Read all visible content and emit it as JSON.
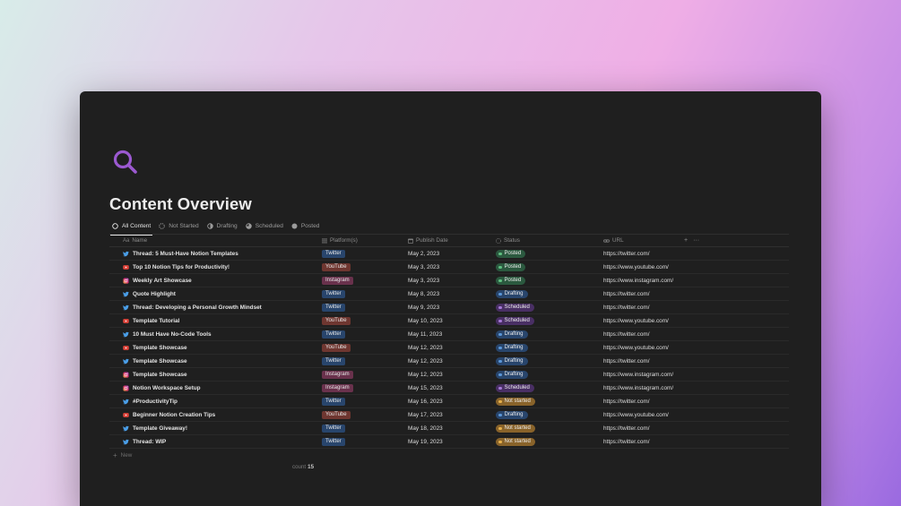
{
  "page": {
    "title": "Content Overview",
    "icon": "search-icon",
    "accent": "#9b59d0"
  },
  "tabs": [
    {
      "label": "All Content",
      "icon": "circle-outline-icon",
      "active": true
    },
    {
      "label": "Not Started",
      "icon": "circle-empty-icon",
      "active": false
    },
    {
      "label": "Drafting",
      "icon": "circle-half-icon",
      "active": false
    },
    {
      "label": "Scheduled",
      "icon": "circle-three-quarter-icon",
      "active": false
    },
    {
      "label": "Posted",
      "icon": "circle-full-icon",
      "active": false
    }
  ],
  "columns": {
    "name": {
      "label": "Name",
      "icon": "Aa"
    },
    "platform": {
      "label": "Platform(s)",
      "icon": "list-icon"
    },
    "date": {
      "label": "Publish Date",
      "icon": "calendar-icon"
    },
    "status": {
      "label": "Status",
      "icon": "status-icon"
    },
    "url": {
      "label": "URL",
      "icon": "link-icon"
    },
    "add": "+",
    "more": "···"
  },
  "platform_colors": {
    "Twitter": "#28456c",
    "YouTube": "#6e3630",
    "Instagram": "#69314c"
  },
  "status_colors": {
    "Posted": {
      "bg": "#2b593f",
      "dot": "#5fbf80"
    },
    "Drafting": {
      "bg": "#28456c",
      "dot": "#5b97d8"
    },
    "Scheduled": {
      "bg": "#492f64",
      "dot": "#a57ad6"
    },
    "Not started": {
      "bg": "#89632a",
      "dot": "#e6b04c"
    }
  },
  "rows": [
    {
      "name": "Thread: 5 Must-Have Notion Templates",
      "platform": "Twitter",
      "date": "May 2, 2023",
      "status": "Posted",
      "url": "https://twitter.com/"
    },
    {
      "name": "Top 10 Notion Tips for Productivity!",
      "platform": "YouTube",
      "date": "May 3, 2023",
      "status": "Posted",
      "url": "https://www.youtube.com/"
    },
    {
      "name": "Weekly Art Showcase",
      "platform": "Instagram",
      "date": "May 3, 2023",
      "status": "Posted",
      "url": "https://www.instagram.com/"
    },
    {
      "name": "Quote Highlight",
      "platform": "Twitter",
      "date": "May 8, 2023",
      "status": "Drafting",
      "url": "https://twitter.com/"
    },
    {
      "name": "Thread: Developing a Personal Growth Mindset",
      "platform": "Twitter",
      "date": "May 9, 2023",
      "status": "Scheduled",
      "url": "https://twitter.com/"
    },
    {
      "name": "Template Tutorial",
      "platform": "YouTube",
      "date": "May 10, 2023",
      "status": "Scheduled",
      "url": "https://www.youtube.com/"
    },
    {
      "name": "10 Must Have No-Code Tools",
      "platform": "Twitter",
      "date": "May 11, 2023",
      "status": "Drafting",
      "url": "https://twitter.com/"
    },
    {
      "name": "Template Showcase",
      "platform": "YouTube",
      "date": "May 12, 2023",
      "status": "Drafting",
      "url": "https://www.youtube.com/"
    },
    {
      "name": "Template Showcase",
      "platform": "Twitter",
      "date": "May 12, 2023",
      "status": "Drafting",
      "url": "https://twitter.com/"
    },
    {
      "name": "Template Showcase",
      "platform": "Instagram",
      "date": "May 12, 2023",
      "status": "Drafting",
      "url": "https://www.instagram.com/"
    },
    {
      "name": "Notion Workspace Setup",
      "platform": "Instagram",
      "date": "May 15, 2023",
      "status": "Scheduled",
      "url": "https://www.instagram.com/"
    },
    {
      "name": "#ProductivityTip",
      "platform": "Twitter",
      "date": "May 16, 2023",
      "status": "Not started",
      "url": "https://twitter.com/"
    },
    {
      "name": "Beginner Notion Creation Tips",
      "platform": "YouTube",
      "date": "May 17, 2023",
      "status": "Drafting",
      "url": "https://www.youtube.com/"
    },
    {
      "name": "Template Giveaway!",
      "platform": "Twitter",
      "date": "May 18, 2023",
      "status": "Not started",
      "url": "https://twitter.com/"
    },
    {
      "name": "Thread: WIP",
      "platform": "Twitter",
      "date": "May 19, 2023",
      "status": "Not started",
      "url": "https://twitter.com/"
    }
  ],
  "new_label": "New",
  "count": {
    "label": "COUNT",
    "value": "15"
  }
}
